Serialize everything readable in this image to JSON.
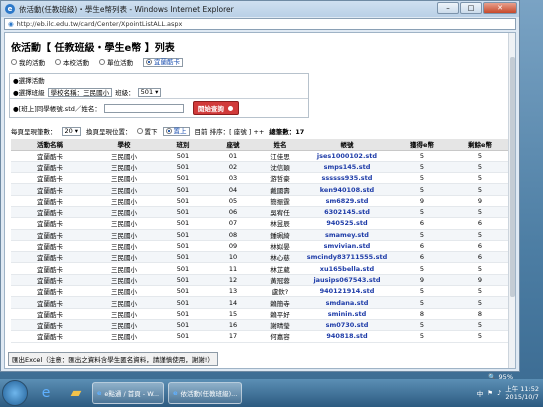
{
  "window": {
    "title": "依活動(任教班級)・學生e幣列表 - Windows Internet Explorer",
    "url": "http://eb.ilc.edu.tw/card/Center/XpointListALL.aspx",
    "min": "–",
    "max": "□",
    "close": "✕"
  },
  "page": {
    "heading": "依活動【 任教班級・學生e幣 】列表",
    "modes": [
      {
        "label": "我的活動",
        "selected": false
      },
      {
        "label": "本校活動",
        "selected": false
      },
      {
        "label": "單位活動",
        "selected": false
      },
      {
        "label": "宜蘭酷卡",
        "selected": true
      }
    ],
    "filter": {
      "activity_label": "●選擇活動",
      "class_label": "●選擇班級",
      "school_label": "學校名稱：三民國小",
      "class_field_label": "班級：",
      "class_value": "501",
      "query_label": "●[班上]同學帳號.std／姓名：",
      "query_value": "",
      "go_label": "開始查詢"
    },
    "controls": {
      "per_page_label": "每頁呈現筆數：",
      "per_page_value": "20",
      "pos_label": "換頁呈現位置：",
      "pos_opt1": "置下",
      "pos_opt2": "置上",
      "sort_label": "目前 排序：[ 座號 ] ++",
      "total_label": "總筆數：17"
    },
    "table": {
      "headers": [
        "活動名稱",
        "學校",
        "班別",
        "座號",
        "姓名",
        "帳號",
        "獲得e幣",
        "剩餘e幣"
      ],
      "rows": [
        [
          "宜蘭酷卡",
          "三民國小",
          "501",
          "01",
          "江佳思",
          "jses1000102.std",
          "5",
          "5"
        ],
        [
          "宜蘭酷卡",
          "三民國小",
          "501",
          "02",
          "沈信穎",
          "smps145.std",
          "5",
          "5"
        ],
        [
          "宜蘭酷卡",
          "三民國小",
          "501",
          "03",
          "游哲豪",
          "ssssss935.std",
          "5",
          "5"
        ],
        [
          "宜蘭酷卡",
          "三民國小",
          "501",
          "04",
          "戴國壽",
          "ken940108.std",
          "5",
          "5"
        ],
        [
          "宜蘭酷卡",
          "三民國小",
          "501",
          "05",
          "簡振霆",
          "sm6829.std",
          "9",
          "9"
        ],
        [
          "宜蘭酷卡",
          "三民國小",
          "501",
          "06",
          "吳宥任",
          "6302145.std",
          "5",
          "5"
        ],
        [
          "宜蘭酷卡",
          "三民國小",
          "501",
          "07",
          "林昱辰",
          "940525.std",
          "6",
          "6"
        ],
        [
          "宜蘭酷卡",
          "三民國小",
          "501",
          "08",
          "鍾珮綺",
          "smamey.std",
          "5",
          "5"
        ],
        [
          "宜蘭酷卡",
          "三民國小",
          "501",
          "09",
          "林姒晏",
          "smvivian.std",
          "6",
          "6"
        ],
        [
          "宜蘭酷卡",
          "三民國小",
          "501",
          "10",
          "林心慈",
          "smcindy83711555.std",
          "6",
          "6"
        ],
        [
          "宜蘭酷卡",
          "三民國小",
          "501",
          "11",
          "林芷葳",
          "xu165bella.std",
          "5",
          "5"
        ],
        [
          "宜蘭酷卡",
          "三民國小",
          "501",
          "12",
          "黃冠蓉",
          "jausips067543.std",
          "9",
          "9"
        ],
        [
          "宜蘭酷卡",
          "三民國小",
          "501",
          "13",
          "盧欽?",
          "940121914.std",
          "5",
          "5"
        ],
        [
          "宜蘭酷卡",
          "三民國小",
          "501",
          "14",
          "賴簡寺",
          "smdana.std",
          "5",
          "5"
        ],
        [
          "宜蘭酷卡",
          "三民國小",
          "501",
          "15",
          "賴平好",
          "sminin.std",
          "8",
          "8"
        ],
        [
          "宜蘭酷卡",
          "三民國小",
          "501",
          "16",
          "謝晴瑩",
          "sm0730.std",
          "5",
          "5"
        ],
        [
          "宜蘭酷卡",
          "三民國小",
          "501",
          "17",
          "何嘉容",
          "940818.std",
          "5",
          "5"
        ]
      ]
    },
    "excel_label": "匯出Excel（注意：匯出之資料含學生匿名資料，請謹慎使用，謝謝!）"
  },
  "status": {
    "zoom": "95%"
  },
  "taskbar": {
    "task1": "e點通 / 首頁 - W...",
    "task2": "依活動(任教班級)...",
    "lang": "中",
    "time": "上午 11:52",
    "date": "2015/10/7"
  }
}
